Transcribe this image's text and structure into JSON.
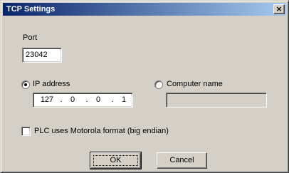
{
  "window": {
    "title": "TCP Settings",
    "close_glyph": "×"
  },
  "port": {
    "label": "Port",
    "value": "23042"
  },
  "ip_address": {
    "label": "IP address",
    "selected": true,
    "octets": [
      "127",
      "0",
      "0",
      "1"
    ],
    "separator": "."
  },
  "computer_name": {
    "label": "Computer name",
    "selected": false,
    "value": "",
    "enabled": false
  },
  "motorola": {
    "label": "PLC uses Motorola format (big endian)",
    "checked": false
  },
  "buttons": {
    "ok": "OK",
    "cancel": "Cancel"
  },
  "icons": {
    "close": "close-icon"
  }
}
